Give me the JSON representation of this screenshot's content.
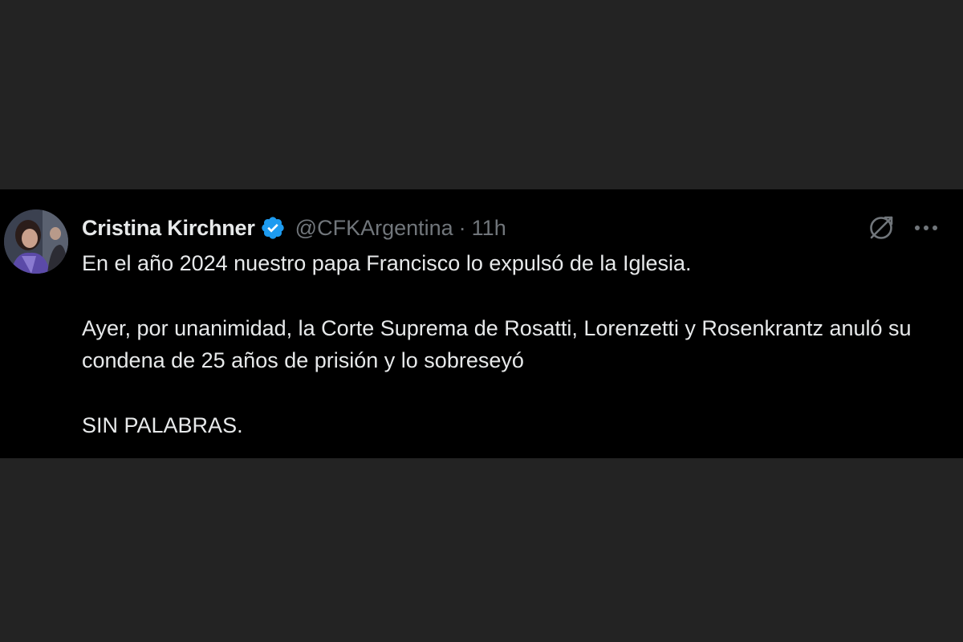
{
  "tweet": {
    "author": {
      "display_name": "Cristina Kirchner",
      "handle": "@CFKArgentina",
      "verified": true,
      "verified_color": "#1d9bf0"
    },
    "separator": "·",
    "time": "11h",
    "paragraphs": [
      "En el año 2024 nuestro papa Francisco lo expulsó de la Iglesia.",
      "Ayer, por unanimidad, la Corte Suprema de Rosatti, Lorenzetti y Rosenkrantz anuló su condena de 25 años de prisión y lo sobreseyó",
      "SIN PALABRAS."
    ],
    "actions": {
      "grok_icon": "grok-icon",
      "more_icon": "more-options-icon"
    }
  },
  "colors": {
    "page_background": "#232323",
    "tweet_background": "#000000",
    "primary_text": "#e7e9ea",
    "secondary_text": "#71767b"
  }
}
